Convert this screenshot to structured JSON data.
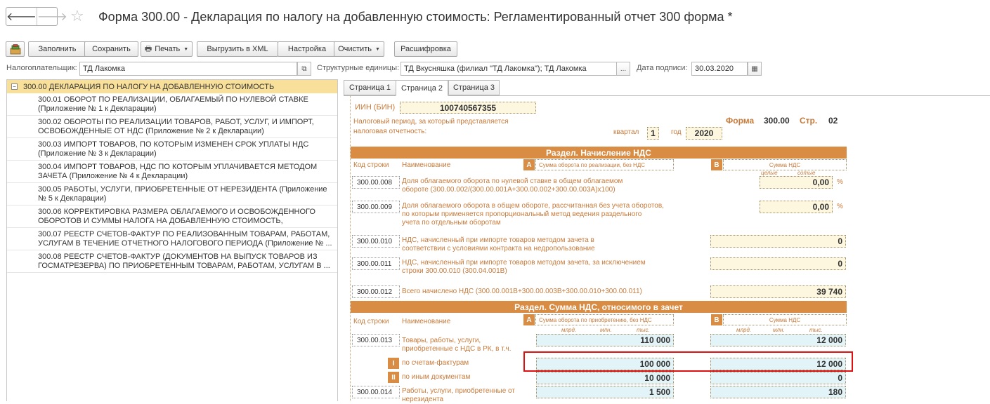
{
  "window": {
    "title": "Форма 300.00 - Декларация по налогу на добавленную стоимость: Регламентированный отчет 300 форма *",
    "back_glyph": "🡐",
    "forward_glyph": "🡒",
    "star_glyph": "☆"
  },
  "toolbar": {
    "fill": "Заполнить",
    "save": "Сохранить",
    "print": "Печать",
    "export_xml": "Выгрузить в XML",
    "settings": "Настройка",
    "clear": "Очистить",
    "decode": "Расшифровка",
    "caret": "▼",
    "print_icon": "🖶"
  },
  "filters": {
    "taxpayer_label": "Налогоплательщик:",
    "taxpayer_value": "ТД Лакомка",
    "units_label": "Структурные единицы:",
    "units_value": "ТД Вкусняшка (филиал \"ТД Лакомка\"); ТД Лакомка",
    "units_btn": "...",
    "sign_date_label": "Дата подписи:",
    "sign_date_value": "30.03.2020",
    "open_glyph": "⧉",
    "calendar_glyph": "▦"
  },
  "tree": {
    "root": "300.00 ДЕКЛАРАЦИЯ ПО НАЛОГУ НА ДОБАВЛЕННУЮ СТОИМОСТЬ",
    "minus": "−",
    "items": [
      {
        "l1": "300.01 ОБОРОТ ПО РЕАЛИЗАЦИИ, ОБЛАГАЕМЫЙ ПО НУЛЕВОЙ СТАВКЕ",
        "l2": "(Приложение № 1 к Декларации)"
      },
      {
        "l1": "300.02 ОБОРОТЫ ПО  РЕАЛИЗАЦИИ ТОВАРОВ, РАБОТ, УСЛУГ, И ИМПОРТ,",
        "l2": "ОСВОБОЖДЕННЫЕ ОТ НДС (Приложение № 2 к Декларации)"
      },
      {
        "l1": "300.03 ИМПОРТ ТОВАРОВ, ПО КОТОРЫМ ИЗМЕНЕН СРОК УПЛАТЫ НДС",
        "l2": "(Приложение № 3 к Декларации)"
      },
      {
        "l1": "300.04 ИМПОРТ ТОВАРОВ, НДС ПО КОТОРЫМ УПЛАЧИВАЕТСЯ МЕТОДОМ",
        "l2": "ЗАЧЕТА (Приложение № 4 к Декларации)"
      },
      {
        "l1": "300.05 РАБОТЫ, УСЛУГИ, ПРИОБРЕТЕННЫЕ ОТ НЕРЕЗИДЕНТА (Приложение",
        "l2": "№ 5 к Декларации)"
      },
      {
        "l1": "300.06 КОРРЕКТИРОВКА РАЗМЕРА ОБЛАГАЕМОГО И ОСВОБОЖДЕННОГО",
        "l2": "ОБОРОТОВ И СУММЫ НАЛОГА НА ДОБАВЛЕННУЮ СТОИМОСТЬ,"
      },
      {
        "l1": "300.07 РЕЕСТР СЧЕТОВ-ФАКТУР ПО РЕАЛИЗОВАННЫМ ТОВАРАМ, РАБОТАМ,",
        "l2": "УСЛУГАМ В ТЕЧЕНИЕ ОТЧЕТНОГО НАЛОГОВОГО ПЕРИОДА (Приложение № ..."
      },
      {
        "l1": "300.08 РЕЕСТР СЧЕТОВ-ФАКТУР (ДОКУМЕНТОВ НА ВЫПУСК ТОВАРОВ ИЗ",
        "l2": "ГОСМАТРЕЗЕРВА) ПО ПРИОБРЕТЕННЫМ ТОВАРАМ, РАБОТАМ, УСЛУГАМ В ..."
      }
    ]
  },
  "tabs": [
    "Страница 1",
    "Страница 2",
    "Страница 3"
  ],
  "form": {
    "iin_label": "ИИН (БИН)",
    "iin_value": "100740567355",
    "period_label_1": "Налоговый период, за который представляется",
    "period_label_2": "налоговая отчетность:",
    "quarter_label": "квартал",
    "quarter_value": "1",
    "year_label": "год",
    "year_value": "2020",
    "form_label": "Форма",
    "form_number": "300.00",
    "page_label": "Стр.",
    "page_number": "02",
    "section1_title": "Раздел. Начисление НДС",
    "section2_title": "Раздел. Сумма НДС, относимого в зачет",
    "col_code": "Код строки",
    "col_name": "Наименование",
    "col_a_letter": "A",
    "col_b_letter": "B",
    "col_a_sales": "Сумма оборота по реализации, без НДС",
    "col_b_vat": "Сумма НДС",
    "col_a_purchase": "Сумма оборота по приобретению, без НДС",
    "sub_whole": "целые",
    "sub_hundredths": "сотые",
    "sub_bln": "млрд.",
    "sub_mln": "млн.",
    "sub_ths": "тыс.",
    "percent": "%",
    "rows": {
      "r008": {
        "code": "300.00.008",
        "l1": "Доля облагаемого оборота по нулевой ставке в общем облагаемом",
        "l2": "обороте (300.00.002/(300.00.001А+300.00.002+300.00.003А)х100)",
        "b": "0,00"
      },
      "r009": {
        "code": "300.00.009",
        "l1": "Доля облагаемого оборота в общем обороте, рассчитанная без учета оборотов,",
        "l2": "по которым применяется пропорциональный метод ведения раздельного",
        "l3": "учета по отдельным оборотам",
        "b": "0,00"
      },
      "r010": {
        "code": "300.00.010",
        "l1": "НДС, начисленный при импорте товаров методом зачета в",
        "l2": "соответствии с условиями контракта на недропользование",
        "b": "0"
      },
      "r011": {
        "code": "300.00.011",
        "l1": "НДС, начисленный при импорте товаров методом зачета, за исключением",
        "l2": "строки 300.00.010 (300.04.001В)",
        "b": "0"
      },
      "r012": {
        "code": "300.00.012",
        "l1": "Всего начислено НДС (300.00.001В+300.00.003В+300.00.010+300.00.011)",
        "b": "39 740"
      },
      "r013": {
        "code": "300.00.013",
        "l1": "Товары, работы, услуги,",
        "l2": "приобретенные с НДС в РК, в т.ч.",
        "a": "110 000",
        "b": "12 000"
      },
      "r013_1": {
        "roman": "I",
        "l1": "по счетам-фактурам",
        "a": "100 000",
        "b": "12 000"
      },
      "r013_2": {
        "roman": "II",
        "l1": "по иным документам",
        "a": "10 000",
        "b": "0"
      },
      "r014": {
        "code": "300.00.014",
        "l1": "Работы, услуги, приобретенные от",
        "l2": "нерезидента",
        "a": "1 500",
        "b": "180"
      }
    }
  }
}
